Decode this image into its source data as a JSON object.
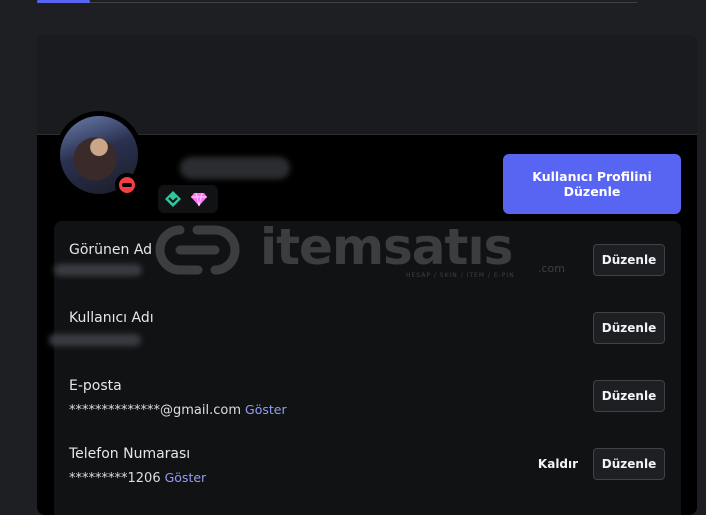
{
  "profile": {
    "edit_profile_label": "Kullanıcı Profilini Düzenle",
    "badges": [
      "hypesquad-balance-icon",
      "nitro-gem-icon"
    ]
  },
  "fields": [
    {
      "label": "Görünen Ad",
      "value": "",
      "edit_label": "Düzenle"
    },
    {
      "label": "Kullanıcı Adı",
      "value": "",
      "edit_label": "Düzenle"
    },
    {
      "label": "E-posta",
      "value": "**************@gmail.com",
      "show_label": "Göster",
      "edit_label": "Düzenle"
    },
    {
      "label": "Telefon Numarası",
      "value": "*********1206",
      "show_label": "Göster",
      "remove_label": "Kaldır",
      "edit_label": "Düzenle"
    }
  ],
  "watermark": {
    "text": "itemsatıs",
    "sub": "HESAP / SKIN / ITEM / E-PIN",
    "domain": ".com"
  },
  "colors": {
    "accent": "#5865f2",
    "link": "#949cf7",
    "status_dnd": "#f23f43"
  }
}
